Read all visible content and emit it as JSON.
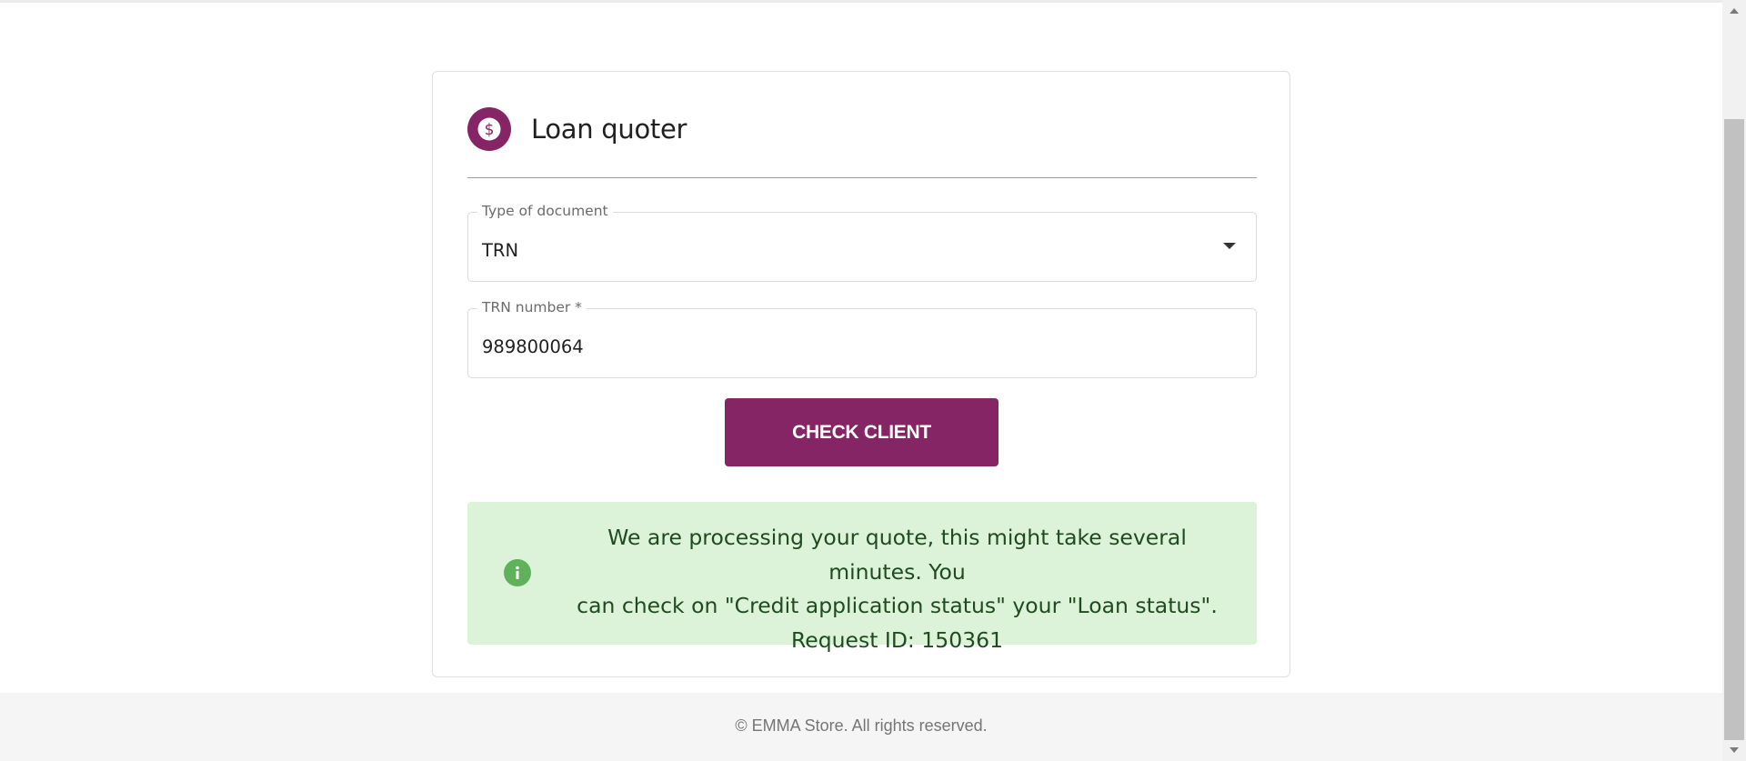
{
  "colors": {
    "brand": "#862565",
    "alert_background": "#dcf2d9",
    "alert_icon": "#5fb25a",
    "alert_text": "#1f4b1f"
  },
  "card": {
    "title": "Loan quoter",
    "header_icon": "dollar-circle-icon"
  },
  "form": {
    "document_type": {
      "label": "Type of document",
      "value": "TRN",
      "icon": "caret-down-icon"
    },
    "trn_number": {
      "label": "TRN number *",
      "value": "989800064"
    },
    "check_button_label": "CHECK CLIENT"
  },
  "alert": {
    "icon": "info-icon",
    "message_line1": "We are processing your quote, this might take several minutes. You",
    "message_line2": "can check on \"Credit application status\" your \"Loan status\".",
    "message_line3": "Request ID: 150361"
  },
  "footer": {
    "text": "© EMMA Store. All rights reserved."
  }
}
